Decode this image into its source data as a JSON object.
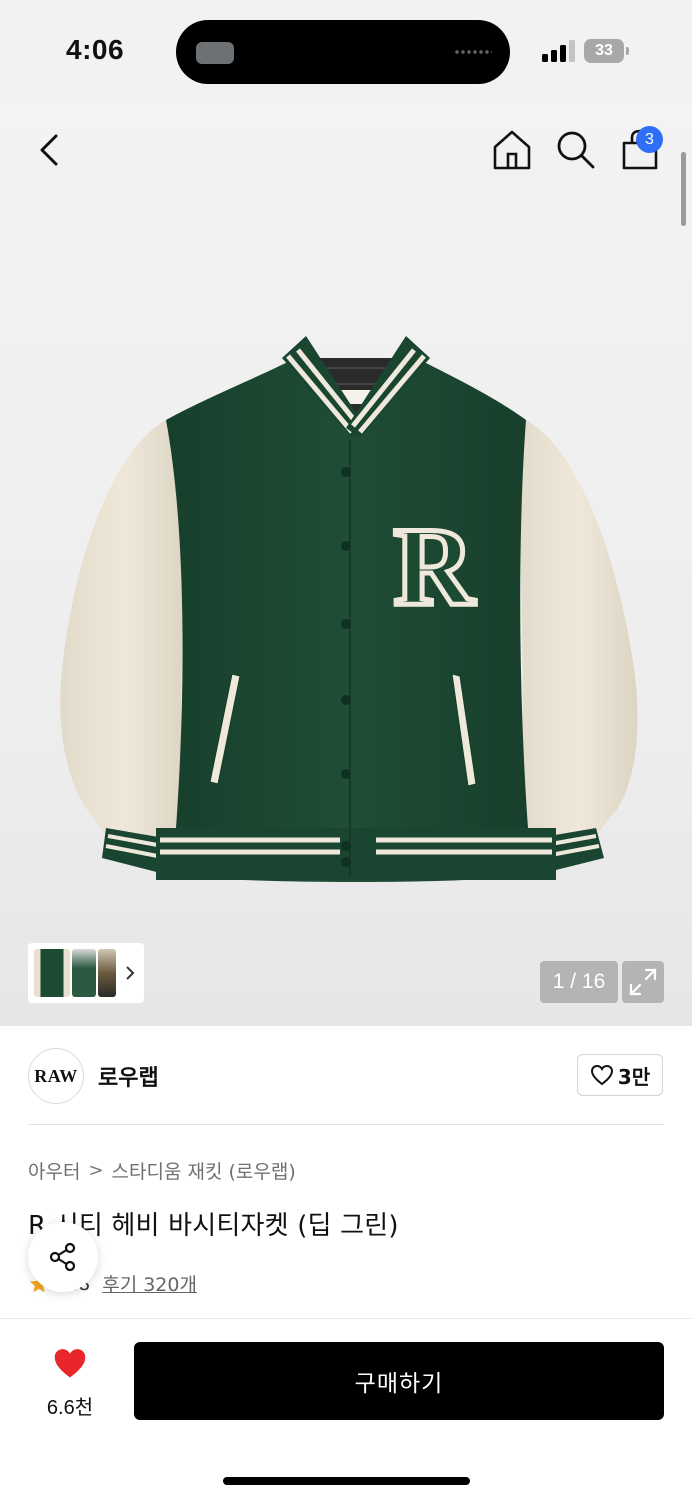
{
  "status_bar": {
    "time": "4:06",
    "battery": "33"
  },
  "header": {
    "cart_count": "3",
    "icons": [
      "back-icon",
      "home-icon",
      "search-icon",
      "shopping-bag-icon"
    ]
  },
  "gallery": {
    "page_counter": "1 / 16",
    "colors": {
      "body": "#1c4a33",
      "sleeve": "#ebe4d6",
      "trim": "#efe9db"
    }
  },
  "brand": {
    "logo_text": "RAW",
    "name": "로우랩",
    "like_count": "3만"
  },
  "breadcrumb": {
    "items": [
      "아우터",
      "스타디움 재킷 (로우랩)"
    ],
    "separator": ">"
  },
  "product": {
    "title": "R 시티 헤비 바시티자켓 (딥 그린)",
    "rating": "4.8",
    "review_link": "후기 320개"
  },
  "bottom_bar": {
    "wish_count": "6.6천",
    "buy_label": "구매하기",
    "accent_red": "#e8262c",
    "badge_blue": "#2f6ff5"
  }
}
